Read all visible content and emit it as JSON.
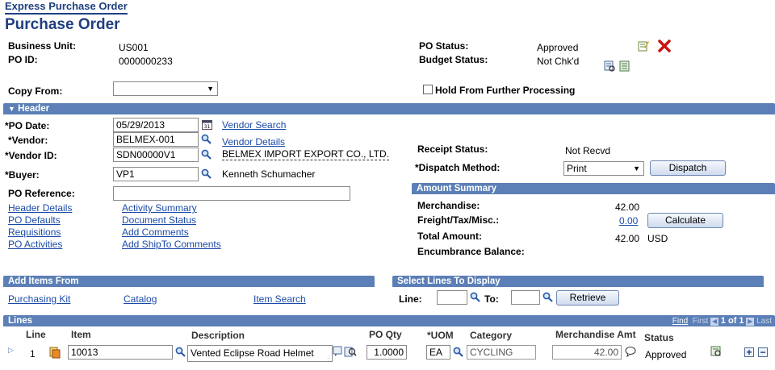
{
  "page": {
    "breadcrumb": "Express Purchase Order",
    "title": "Purchase Order"
  },
  "top": {
    "business_unit_label": "Business Unit:",
    "business_unit": "US001",
    "po_id_label": "PO ID:",
    "po_id": "0000000233",
    "po_status_label": "PO Status:",
    "po_status": "Approved",
    "budget_status_label": "Budget Status:",
    "budget_status": "Not Chk'd",
    "copy_from_label": "Copy From:",
    "copy_from_value": "",
    "hold_label": "Hold From Further Processing"
  },
  "header": {
    "bar_label": "Header",
    "po_date_label": "*PO Date:",
    "po_date": "05/29/2013",
    "vendor_search": "Vendor Search",
    "vendor_label": "*Vendor:",
    "vendor": "BELMEX-001",
    "vendor_details": "Vendor Details",
    "vendor_id_label": "*Vendor ID:",
    "vendor_id": "SDN00000V1",
    "vendor_name": "BELMEX IMPORT EXPORT CO., LTD.",
    "buyer_label": "*Buyer:",
    "buyer": "VP1",
    "buyer_name": "Kenneth Schumacher",
    "po_reference_label": "PO Reference:",
    "po_reference": "",
    "receipt_status_label": "Receipt Status:",
    "receipt_status": "Not Recvd",
    "dispatch_method_label": "*Dispatch Method:",
    "dispatch_method": "Print",
    "dispatch_button": "Dispatch",
    "links_col1": [
      "Header Details",
      "PO Defaults",
      "Requisitions",
      "PO Activities"
    ],
    "links_col2": [
      "Activity Summary",
      "Document Status",
      "Add Comments",
      "Add ShipTo Comments"
    ]
  },
  "amount_summary": {
    "bar_label": "Amount Summary",
    "merchandise_label": "Merchandise:",
    "merchandise": "42.00",
    "freight_label": "Freight/Tax/Misc.:",
    "freight": "0.00",
    "calculate_button": "Calculate",
    "total_label": "Total Amount:",
    "total": "42.00",
    "currency": "USD",
    "encumbrance_label": "Encumbrance Balance:"
  },
  "add_items": {
    "bar_label": "Add Items From",
    "purchasing_kit": "Purchasing Kit",
    "catalog": "Catalog",
    "item_search": "Item Search"
  },
  "select_lines": {
    "bar_label": "Select Lines To Display",
    "line_label": "Line:",
    "to_label": "To:",
    "retrieve_button": "Retrieve"
  },
  "lines": {
    "bar_label": "Lines",
    "nav_find": "Find",
    "nav_first": "First",
    "nav_count": "1 of 1",
    "nav_last": "Last",
    "columns": [
      "Line",
      "Item",
      "Description",
      "PO Qty",
      "*UOM",
      "Category",
      "Merchandise Amt",
      "Status"
    ],
    "rows": [
      {
        "line": "1",
        "item": "10013",
        "description": "Vented Eclipse Road Helmet",
        "po_qty": "1.0000",
        "uom": "EA",
        "category": "CYCLING",
        "merch_amt": "42.00",
        "status": "Approved"
      }
    ]
  },
  "colors": {
    "title": "#1f3f7f",
    "bar": "#5b7fb6",
    "link": "#1a4aa8",
    "delete_x": "#cc1111"
  },
  "icons": [
    "calendar-icon",
    "lookup-icon",
    "edit-icon",
    "delete-icon",
    "budget-icon",
    "item-detail-icon",
    "comment-icon",
    "add-row-icon",
    "delete-row-icon"
  ]
}
